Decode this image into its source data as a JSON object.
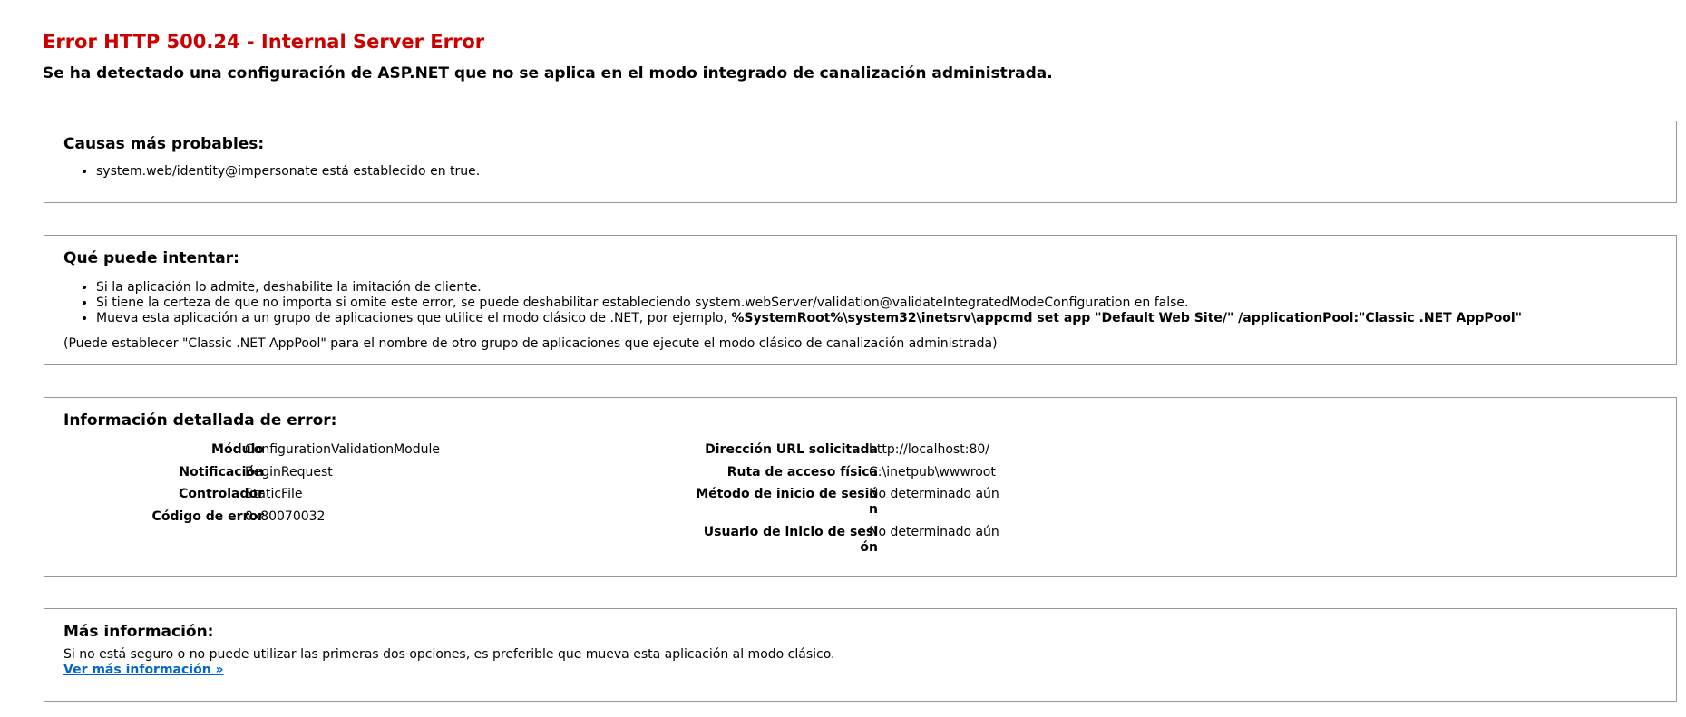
{
  "header": {
    "title": "Error HTTP 500.24 - Internal Server Error",
    "subtitle": "Se ha detectado una configuración de ASP.NET que no se aplica en el modo integrado de canalización administrada."
  },
  "causes": {
    "heading": "Causas más probables:",
    "items": [
      "system.web/identity@impersonate está establecido en true."
    ]
  },
  "try": {
    "heading": "Qué puede intentar:",
    "items": [
      "Si la aplicación lo admite, deshabilite la imitación de cliente.",
      "Si tiene la certeza de que no importa si omite este error, se puede deshabilitar estableciendo system.webServer/validation@validateIntegratedModeConfiguration en false."
    ],
    "item3_prefix": "Mueva esta aplicación a un grupo de aplicaciones que utilice el modo clásico de .NET, por ejemplo, ",
    "item3_code": "%SystemRoot%\\system32\\inetsrv\\appcmd set app \"Default Web Site/\" /applicationPool:\"Classic .NET AppPool\"",
    "note": "(Puede establecer \"Classic .NET AppPool\" para el nombre de otro grupo de aplicaciones que ejecute el modo clásico de canalización administrada)"
  },
  "details": {
    "heading": "Información detallada de error:",
    "left": [
      {
        "label": "Módulo",
        "value": "ConfigurationValidationModule"
      },
      {
        "label": "Notificación",
        "value": "BeginRequest"
      },
      {
        "label": "Controlador",
        "value": "StaticFile"
      },
      {
        "label": "Código de error",
        "value": "0x80070032"
      }
    ],
    "right": [
      {
        "label": "Dirección URL solicitada",
        "value": "http://localhost:80/"
      },
      {
        "label": "Ruta de acceso física",
        "value": "C:\\inetpub\\wwwroot"
      },
      {
        "label_line1": "Método de inicio de sesió",
        "label_line2": "n",
        "value": "No determinado aún"
      },
      {
        "label_line1": "Usuario de inicio de sesi",
        "label_line2": "ón",
        "value": "No determinado aún"
      }
    ]
  },
  "more": {
    "heading": "Más información:",
    "text": "Si no está seguro o no puede utilizar las primeras dos opciones, es preferible que mueva esta aplicación al modo clásico.",
    "link": "Ver más información »"
  },
  "colors": {
    "title": "#cc0000",
    "link": "#0066cc",
    "border": "#999999"
  }
}
